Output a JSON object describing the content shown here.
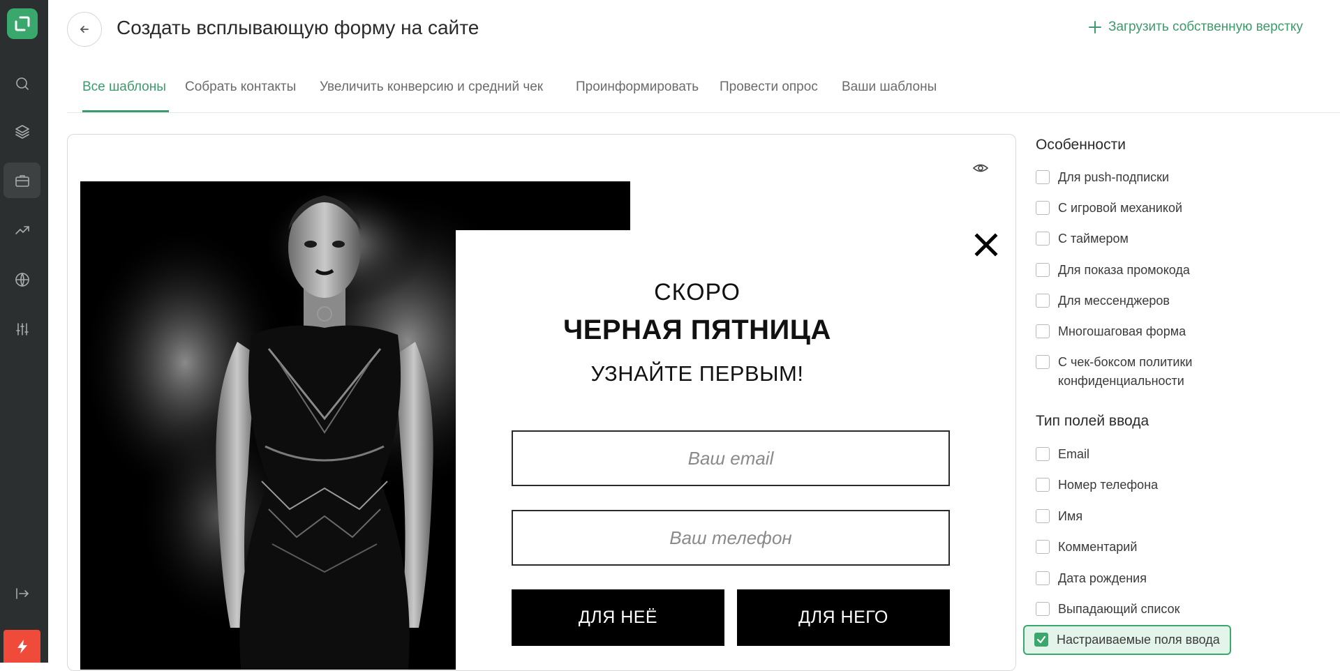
{
  "header": {
    "title": "Создать всплывающую форму на сайте",
    "upload_label": "Загрузить собственную верстку"
  },
  "tabs": [
    {
      "label": "Все шаблоны",
      "active": true
    },
    {
      "label": "Собрать контакты",
      "active": false
    },
    {
      "label": "Увеличить конверсию и средний чек",
      "active": false
    },
    {
      "label": "Проинформировать",
      "active": false
    },
    {
      "label": "Провести опрос",
      "active": false
    },
    {
      "label": "Ваши шаблоны",
      "active": false
    }
  ],
  "preview": {
    "headline_small": "СКОРО",
    "headline_bold": "ЧЕРНАЯ ПЯТНИЦА",
    "headline_sub": "УЗНАЙТЕ ПЕРВЫМ!",
    "email_placeholder": "Ваш email",
    "phone_placeholder": "Ваш телефон",
    "button_her": "ДЛЯ НЕЁ",
    "button_him": "ДЛЯ НЕГО"
  },
  "filters": {
    "features_title": "Особенности",
    "features": [
      {
        "label": "Для push-подписки",
        "checked": false
      },
      {
        "label": "С игровой механикой",
        "checked": false
      },
      {
        "label": "С таймером",
        "checked": false
      },
      {
        "label": "Для показа промокода",
        "checked": false
      },
      {
        "label": "Для мессенджеров",
        "checked": false
      },
      {
        "label": "Многошаговая форма",
        "checked": false
      },
      {
        "label_line1": "С чек-боксом политики",
        "label_line2": "конфиденциальности",
        "checked": false
      }
    ],
    "fields_title": "Тип полей ввода",
    "fields": [
      {
        "label": "Email",
        "checked": false
      },
      {
        "label": "Номер телефона",
        "checked": false
      },
      {
        "label": "Имя",
        "checked": false
      },
      {
        "label": "Комментарий",
        "checked": false
      },
      {
        "label": "Дата рождения",
        "checked": false
      },
      {
        "label": "Выпадающий список",
        "checked": false
      },
      {
        "label": "Настраиваемые поля ввода",
        "checked": true
      }
    ]
  },
  "colors": {
    "accent": "#3c9b6a",
    "sidebar": "#2c2f30",
    "flash": "#f04b3a"
  }
}
